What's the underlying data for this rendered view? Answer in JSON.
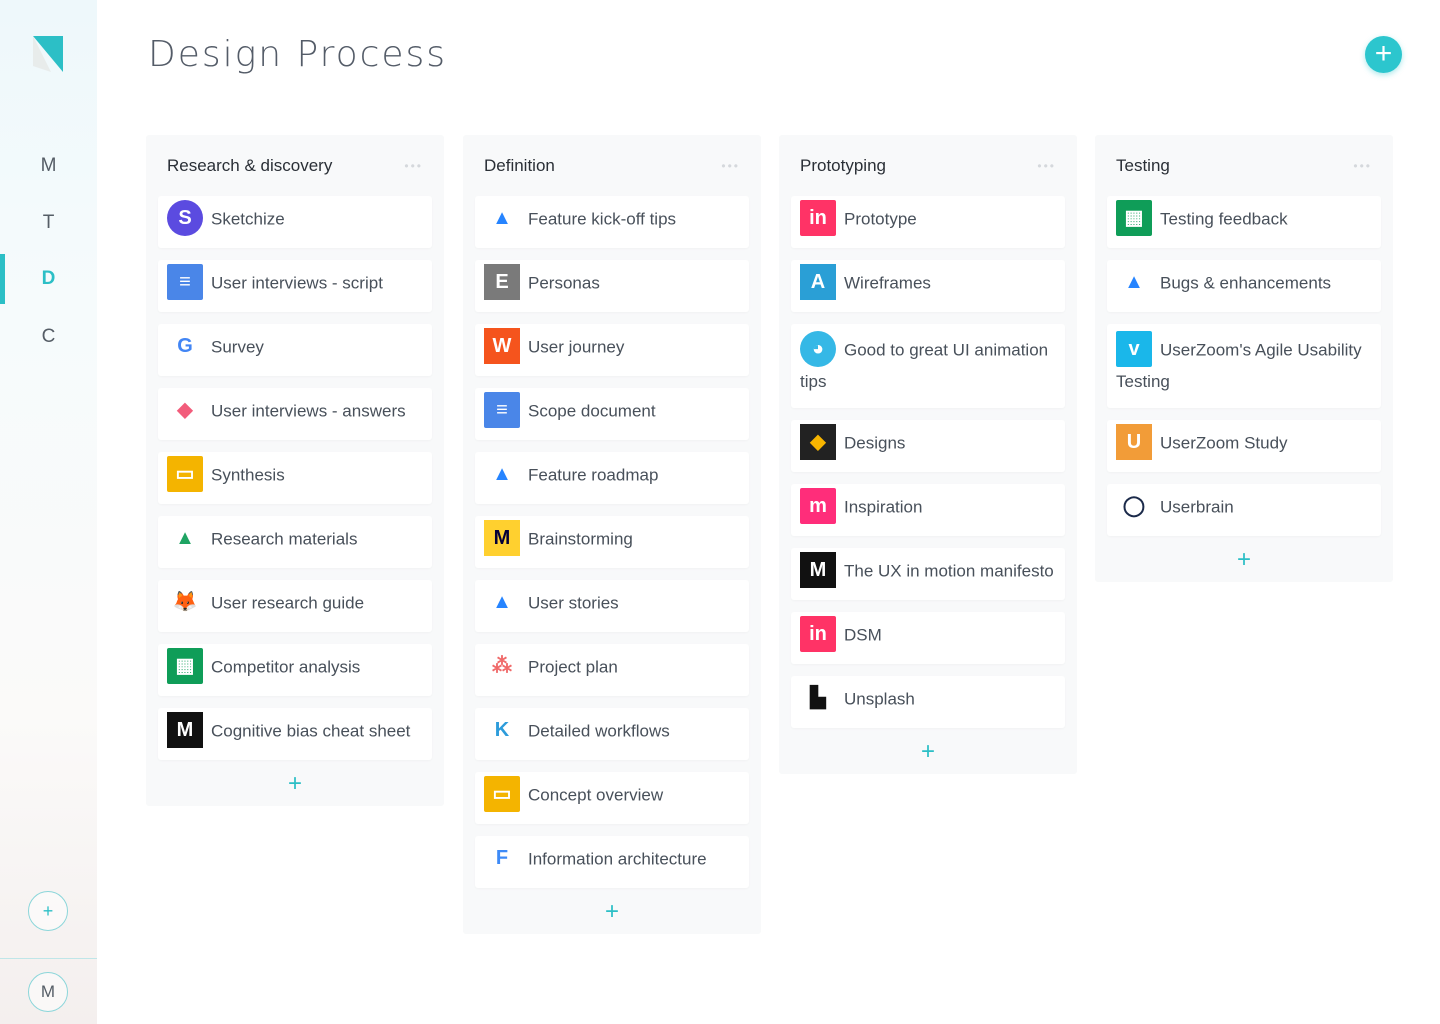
{
  "page_title": "Design Process",
  "sidebar": {
    "items": [
      {
        "label": "M"
      },
      {
        "label": "T"
      },
      {
        "label": "D",
        "active": true
      },
      {
        "label": "C"
      }
    ],
    "add_label": "+",
    "user_initial": "M"
  },
  "accent": "#2cbfc6",
  "columns": [
    {
      "title": "Research & discovery",
      "items": [
        {
          "label": "Sketchize",
          "icon": "sketchize-icon"
        },
        {
          "label": "User interviews - script",
          "icon": "google-docs-icon"
        },
        {
          "label": "Survey",
          "icon": "google-icon"
        },
        {
          "label": "User interviews - answers",
          "icon": "airtable-icon"
        },
        {
          "label": "Synthesis",
          "icon": "google-slides-icon"
        },
        {
          "label": "Research materials",
          "icon": "google-drive-icon"
        },
        {
          "label": "User research guide",
          "icon": "gitlab-fox-icon"
        },
        {
          "label": "Competitor analysis",
          "icon": "google-sheets-icon"
        },
        {
          "label": "Cognitive bias cheat sheet",
          "icon": "medium-icon"
        }
      ]
    },
    {
      "title": "Definition",
      "items": [
        {
          "label": "Feature kick-off tips",
          "icon": "atlassian-icon"
        },
        {
          "label": "Personas",
          "icon": "e-icon"
        },
        {
          "label": "User journey",
          "icon": "w-icon"
        },
        {
          "label": "Scope document",
          "icon": "google-docs-icon"
        },
        {
          "label": "Feature roadmap",
          "icon": "atlassian-icon"
        },
        {
          "label": "Brainstorming",
          "icon": "miro-icon"
        },
        {
          "label": "User stories",
          "icon": "atlassian-icon"
        },
        {
          "label": "Project plan",
          "icon": "asana-icon"
        },
        {
          "label": "Detailed workflows",
          "icon": "kumu-icon"
        },
        {
          "label": "Concept overview",
          "icon": "google-slides-icon"
        },
        {
          "label": "Information architecture",
          "icon": "flowmapp-icon"
        }
      ]
    },
    {
      "title": "Prototyping",
      "items": [
        {
          "label": "Prototype",
          "icon": "invision-icon"
        },
        {
          "label": "Wireframes",
          "icon": "a-icon"
        },
        {
          "label": "Good to great UI animation tips",
          "icon": "bear-icon"
        },
        {
          "label": "Designs",
          "icon": "sketch-icon"
        },
        {
          "label": "Inspiration",
          "icon": "muzli-icon"
        },
        {
          "label": "The UX in motion manifesto",
          "icon": "medium-icon"
        },
        {
          "label": "DSM",
          "icon": "invision-icon"
        },
        {
          "label": "Unsplash",
          "icon": "unsplash-icon"
        }
      ]
    },
    {
      "title": "Testing",
      "items": [
        {
          "label": "Testing feedback",
          "icon": "google-sheets-icon"
        },
        {
          "label": "Bugs & enhancements",
          "icon": "atlassian-icon"
        },
        {
          "label": "UserZoom's Agile Usability Testing",
          "icon": "vimeo-icon"
        },
        {
          "label": "UserZoom Study",
          "icon": "u-icon"
        },
        {
          "label": "Userbrain",
          "icon": "userbrain-icon"
        }
      ]
    }
  ],
  "column_menu_label": "•••",
  "add_card_label": "+",
  "add_column_label": "+"
}
